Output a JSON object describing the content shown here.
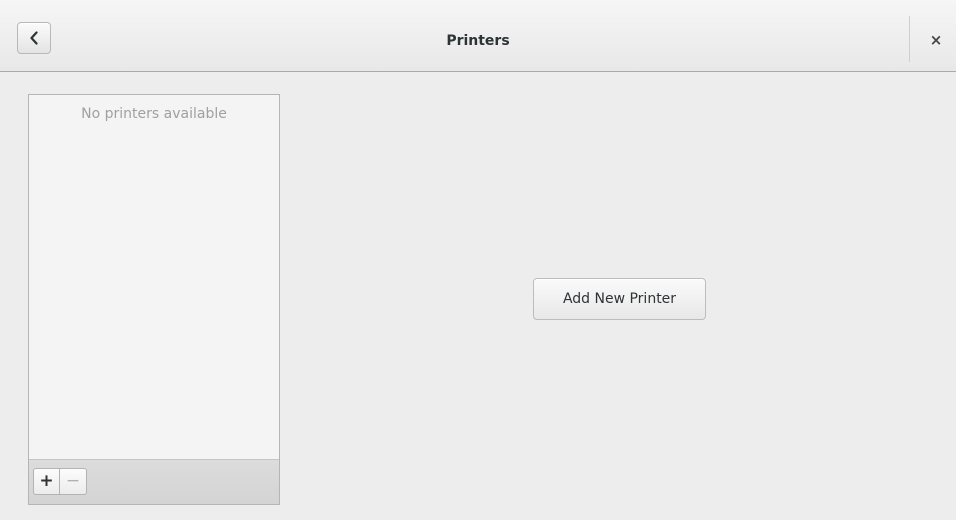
{
  "window": {
    "title": "Printers",
    "back_icon": "chevron-left-icon",
    "close_label": "×"
  },
  "printer_list": {
    "empty_text": "No printers available",
    "add_label": "+",
    "remove_label": "−"
  },
  "main": {
    "add_printer_label": "Add New Printer"
  },
  "colors": {
    "background": "#ededed",
    "headerbar": "#eeeeee",
    "text": "#2e3436",
    "placeholder_text": "#a0a0a0"
  }
}
